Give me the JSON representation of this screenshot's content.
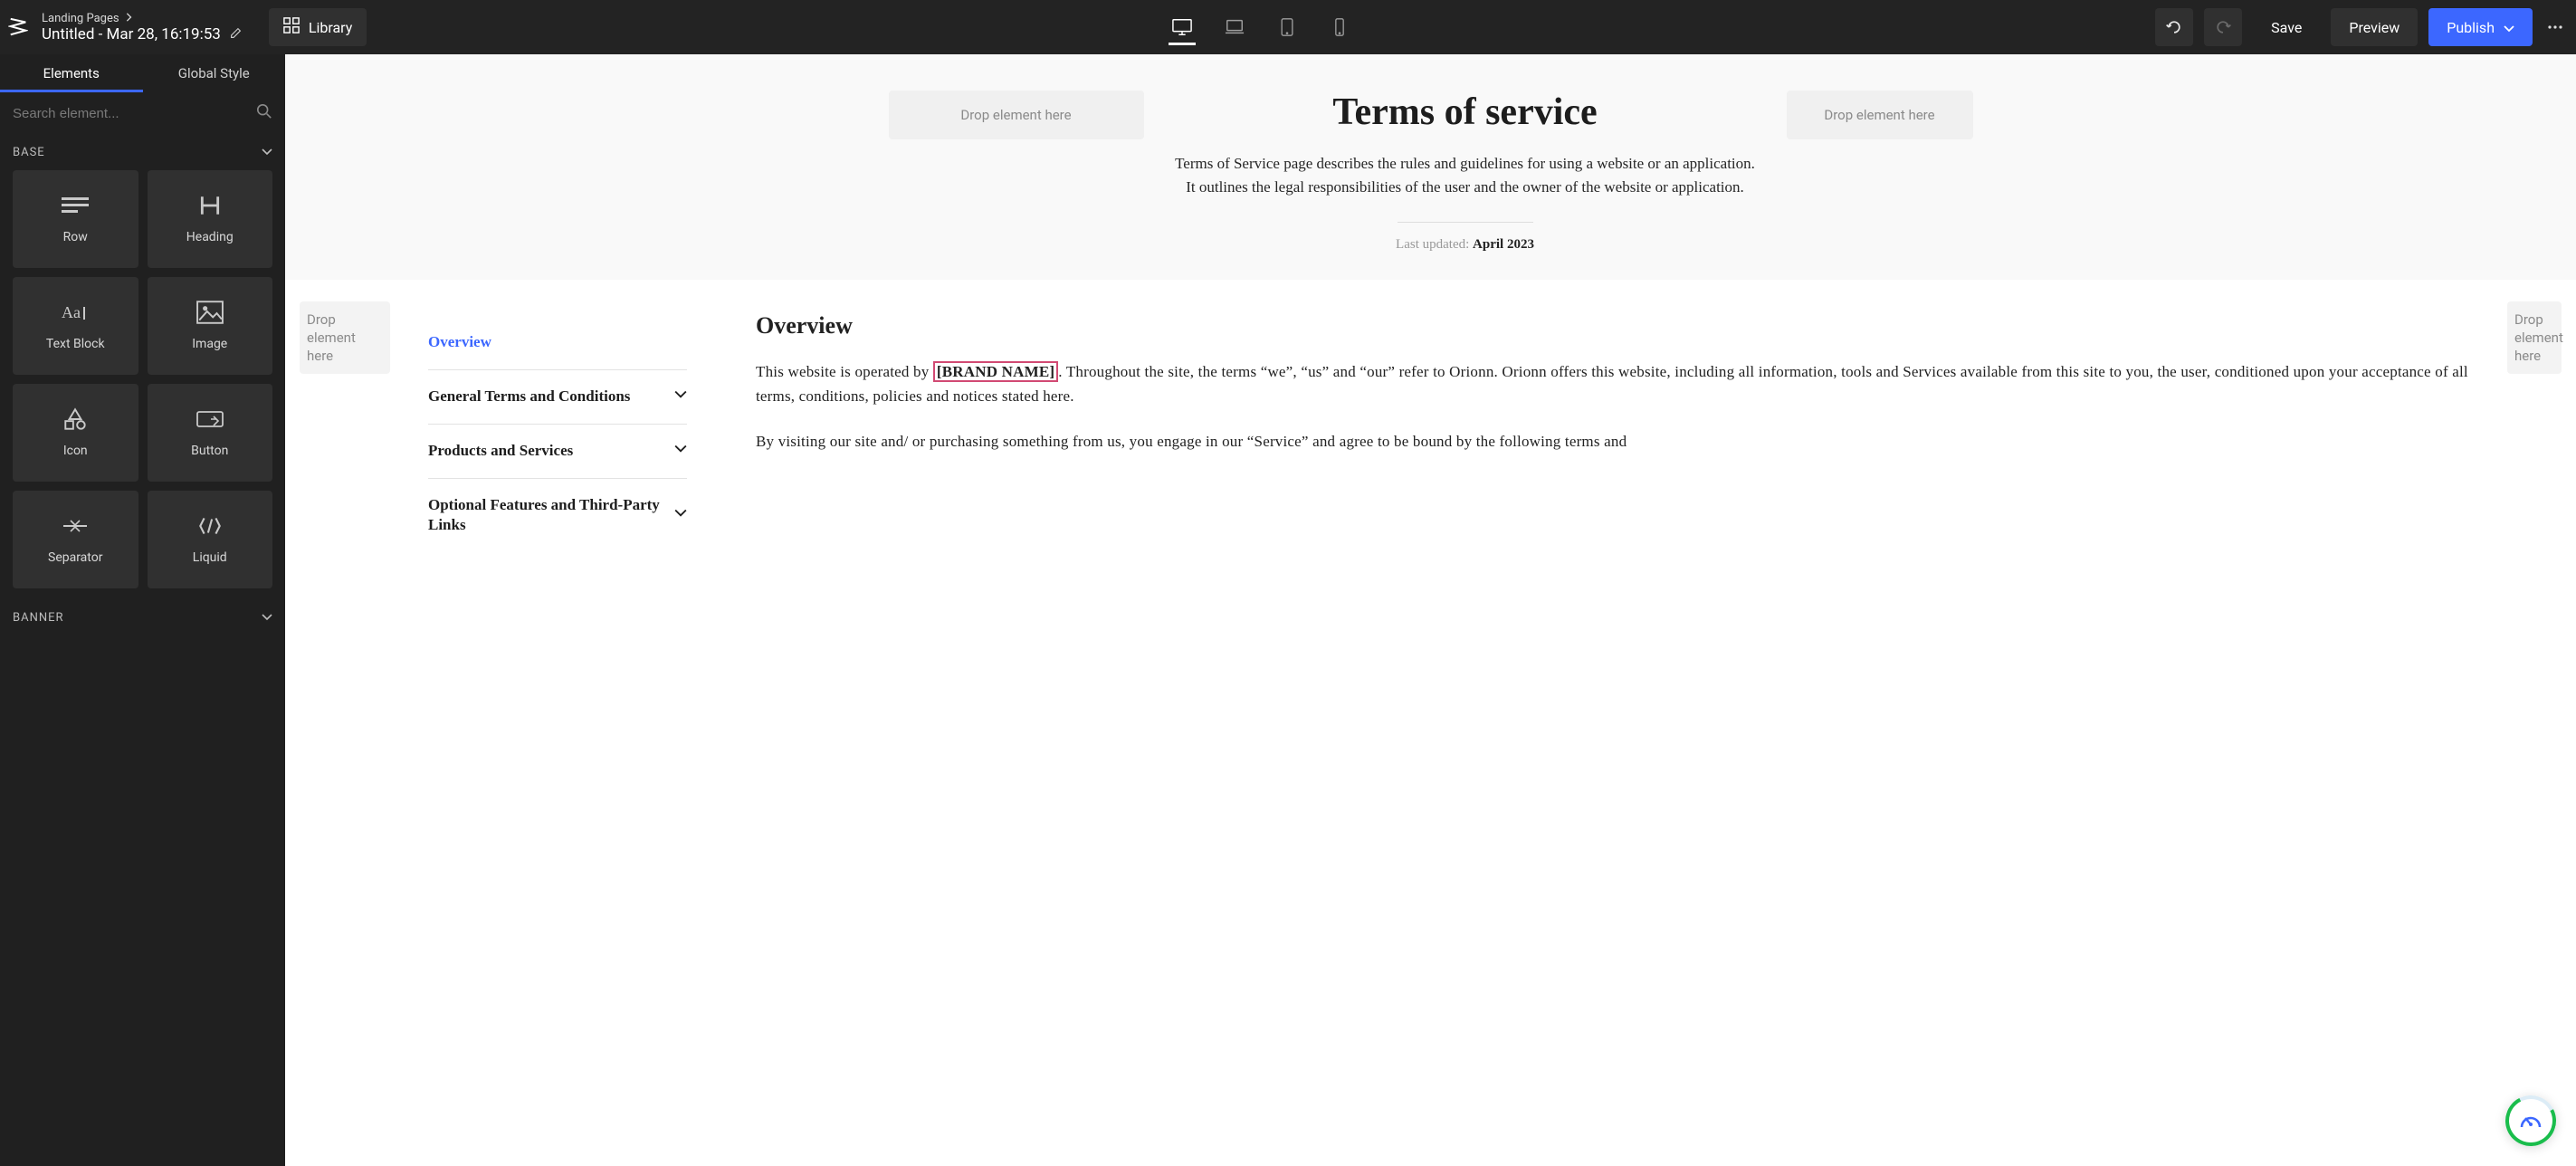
{
  "topbar": {
    "breadcrumb": "Landing Pages",
    "page_title": "Untitled - Mar 28, 16:19:53",
    "library_label": "Library",
    "save_label": "Save",
    "preview_label": "Preview",
    "publish_label": "Publish"
  },
  "sidebar": {
    "tabs": {
      "elements": "Elements",
      "global_style": "Global Style"
    },
    "search_placeholder": "Search element...",
    "groups": {
      "base": {
        "title": "BASE",
        "items": [
          "Row",
          "Heading",
          "Text Block",
          "Image",
          "Icon",
          "Button",
          "Separator",
          "Liquid"
        ]
      },
      "banner": {
        "title": "BANNER"
      }
    }
  },
  "canvas": {
    "drop_text": "Drop element here",
    "drop_line1": "Drop",
    "drop_line2": "element",
    "drop_line3": "here",
    "hero": {
      "title": "Terms of service",
      "subtitle": "Terms of Service page describes the rules and guidelines for using a website or an application. It outlines the legal responsibilities of the user and the owner of the website or application.",
      "last_updated_label": "Last updated: ",
      "last_updated_value": "April 2023"
    },
    "toc": [
      {
        "label": "Overview",
        "active": true,
        "expandable": false
      },
      {
        "label": "General Terms and Conditions",
        "active": false,
        "expandable": true
      },
      {
        "label": "Products and Services",
        "active": false,
        "expandable": true
      },
      {
        "label": "Optional Features and Third-Party Links",
        "active": false,
        "expandable": true
      }
    ],
    "content": {
      "heading": "Overview",
      "p1a": "This website is operated by ",
      "p1_highlight": "[BRAND NAME]",
      "p1b": ". Throughout the site, the terms “we”, “us” and “our” refer to Orionn. Orionn offers this website, including all information, tools and Services available from this site to you, the user, conditioned upon your acceptance of all terms, conditions, policies and notices stated here.",
      "p2": "By visiting our site and/ or purchasing something from us, you engage in our “Service” and agree to be bound by the following terms and"
    }
  }
}
